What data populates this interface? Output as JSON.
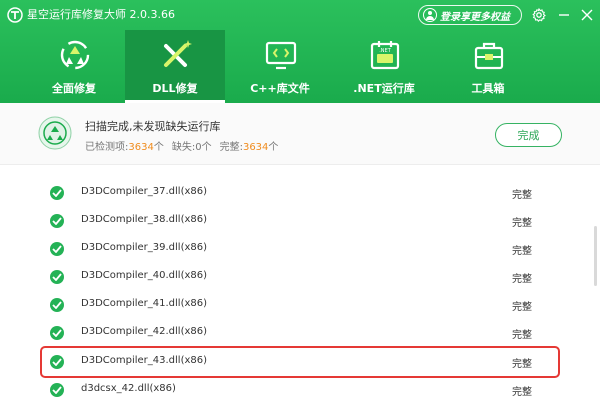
{
  "app": {
    "title": "星空运行库修复大师 2.0.3.66",
    "login_label": "登录享更多权益"
  },
  "colors": {
    "brand": "#1aab4c",
    "accent_orange": "#f08c1e",
    "highlight": "#e53935"
  },
  "nav": {
    "tabs": [
      {
        "label": "全面修复",
        "icon": "recycle-icon",
        "active": false
      },
      {
        "label": "DLL修复",
        "icon": "dll-tools-icon",
        "active": true
      },
      {
        "label": "C++库文件",
        "icon": "code-monitor-icon",
        "active": false
      },
      {
        "label": ".NET运行库",
        "icon": "net-calendar-icon",
        "active": false
      },
      {
        "label": "工具箱",
        "icon": "toolbox-icon",
        "active": false
      }
    ]
  },
  "status": {
    "title": "扫描完成,未发现缺失运行库",
    "detected_label": "已检测项:",
    "detected_count": "3634",
    "unit": "个",
    "missing_label": "缺失:",
    "missing_count": "0",
    "complete_label": "完整:",
    "complete_count": "3634",
    "done_button": "完成"
  },
  "files": [
    {
      "name": "D3DCompiler_37.dll(x86)",
      "status": "完整"
    },
    {
      "name": "D3DCompiler_38.dll(x86)",
      "status": "完整"
    },
    {
      "name": "D3DCompiler_39.dll(x86)",
      "status": "完整"
    },
    {
      "name": "D3DCompiler_40.dll(x86)",
      "status": "完整"
    },
    {
      "name": "D3DCompiler_41.dll(x86)",
      "status": "完整"
    },
    {
      "name": "D3DCompiler_42.dll(x86)",
      "status": "完整"
    },
    {
      "name": "D3DCompiler_43.dll(x86)",
      "status": "完整"
    },
    {
      "name": "d3dcsx_42.dll(x86)",
      "status": "完整"
    }
  ]
}
